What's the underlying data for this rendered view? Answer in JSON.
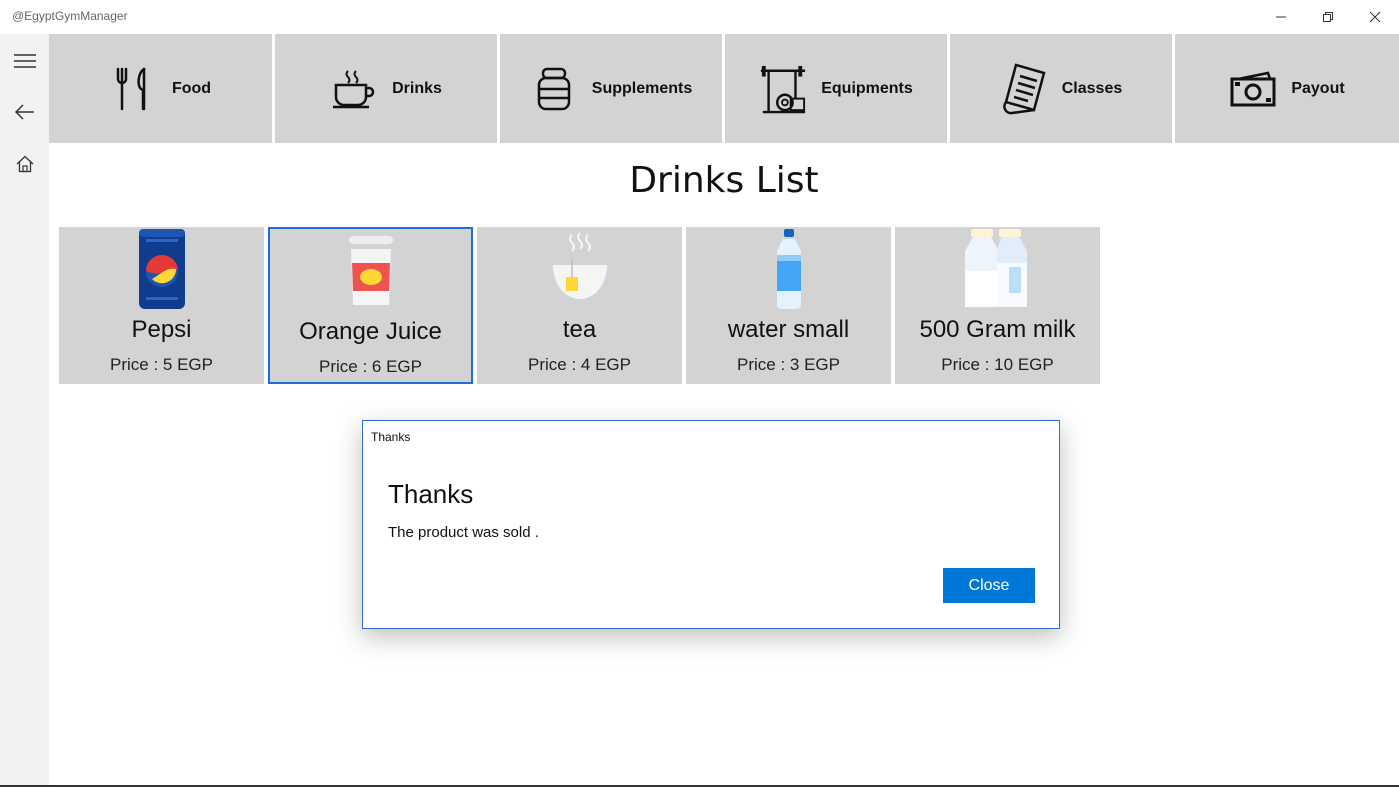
{
  "window": {
    "title": "@EgyptGymManager",
    "controls": [
      "minimize-icon",
      "restore-icon",
      "close-icon"
    ]
  },
  "sidebar": {
    "items": [
      {
        "icon": "hamburger-menu-icon"
      },
      {
        "icon": "back-arrow-icon"
      },
      {
        "icon": "home-icon"
      }
    ]
  },
  "nav": {
    "items": [
      {
        "label": "Food",
        "icon": "fork-knife-icon"
      },
      {
        "label": "Drinks",
        "icon": "coffee-cup-icon"
      },
      {
        "label": "Supplements",
        "icon": "supplement-jar-icon"
      },
      {
        "label": "Equipments",
        "icon": "barbell-rack-icon"
      },
      {
        "label": "Classes",
        "icon": "document-list-icon"
      },
      {
        "label": "Payout",
        "icon": "money-icon"
      }
    ]
  },
  "page": {
    "title": "Drinks List"
  },
  "products": [
    {
      "name": "Pepsi",
      "price": "Price : 5 EGP",
      "icon": "soda-can-icon"
    },
    {
      "name": "Orange Juice",
      "price": "Price : 6 EGP",
      "icon": "juice-cup-icon",
      "selected": true
    },
    {
      "name": "tea",
      "price": "Price : 4 EGP",
      "icon": "tea-bowl-icon"
    },
    {
      "name": "water small",
      "price": "Price : 3 EGP",
      "icon": "water-bottle-icon"
    },
    {
      "name": "500 Gram milk",
      "price": "Price : 10 EGP",
      "icon": "milk-bottles-icon"
    }
  ],
  "dialog": {
    "caption": "Thanks",
    "title": "Thanks",
    "message": "The product was sold .",
    "close_label": "Close"
  },
  "colors": {
    "accent": "#0078d7",
    "selection_border": "#1f6fd2",
    "tile_background": "#d3d3d3",
    "sidebar_background": "#f2f2f2"
  }
}
